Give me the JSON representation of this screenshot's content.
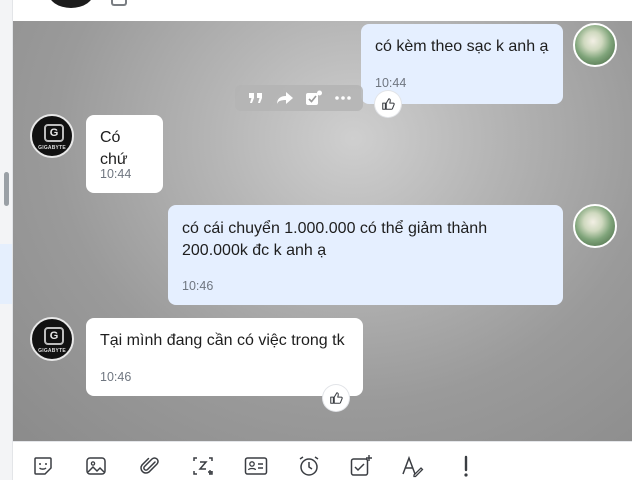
{
  "messages": [
    {
      "direction": "out",
      "text": "có kèm theo sạc k anh ạ",
      "time": "10:44",
      "reaction": "like-icon"
    },
    {
      "direction": "in",
      "sender_avatar": "gigabyte-logo",
      "text": "Có chứ",
      "time": "10:44"
    },
    {
      "direction": "out",
      "text_line1": "có cái chuyển 1.000.000 có thể giảm thành",
      "text_line2": "200.000k đc k anh ạ",
      "time": "10:46"
    },
    {
      "direction": "in",
      "sender_avatar": "gigabyte-logo",
      "text": "Tại mình đang cần có việc trong tk",
      "time": "10:46",
      "reaction": "like-icon"
    }
  ],
  "avatar": {
    "brand": "GIGABYTE"
  },
  "message_actions": [
    "quote-icon",
    "forward-icon",
    "task-icon",
    "more-icon"
  ],
  "toolbar": [
    "sticker-icon",
    "image-icon",
    "attachment-icon",
    "screenshot-icon",
    "contact-card-icon",
    "reminder-icon",
    "todo-icon",
    "format-text-icon",
    "urgent-icon"
  ],
  "colors": {
    "outgoing_bubble": "#e5efff",
    "incoming_bubble": "#ffffff",
    "timestamp": "#6f7680",
    "icon": "#3a3d42"
  }
}
